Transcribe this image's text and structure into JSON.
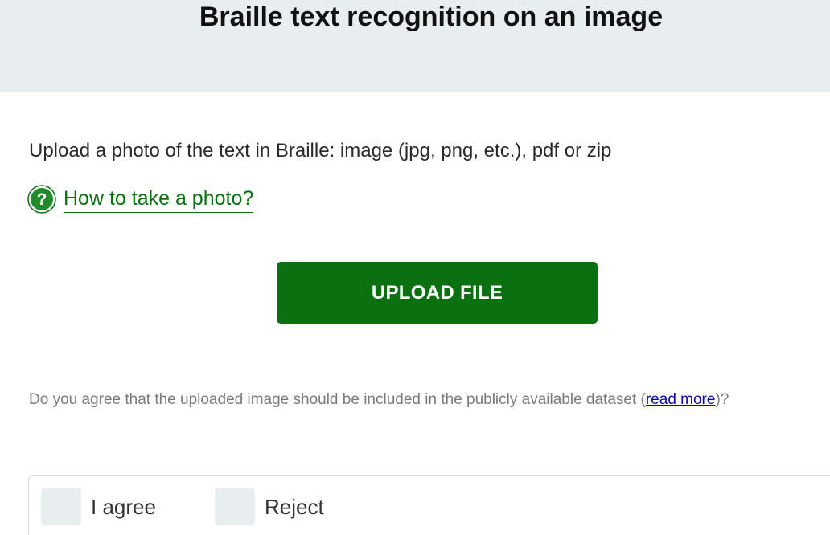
{
  "header": {
    "title": "Braille text recognition on an image"
  },
  "main": {
    "intro": "Upload a photo of the text in Braille: image (jpg, png, etc.), pdf or zip",
    "help_link": "How to take a photo?",
    "help_icon": "question-circle-icon",
    "upload_button": "UPLOAD FILE"
  },
  "consent": {
    "text_before": "Do you agree that the uploaded image should be included in the publicly available dataset (",
    "read_more": "read more",
    "text_after": ")?",
    "options": [
      {
        "label": "I agree"
      },
      {
        "label": "Reject"
      }
    ]
  },
  "colors": {
    "accent": "#0a7010",
    "header_bg": "#e8edf0",
    "link_blue": "#0a0aa8",
    "muted_text": "#7a7a7a"
  }
}
